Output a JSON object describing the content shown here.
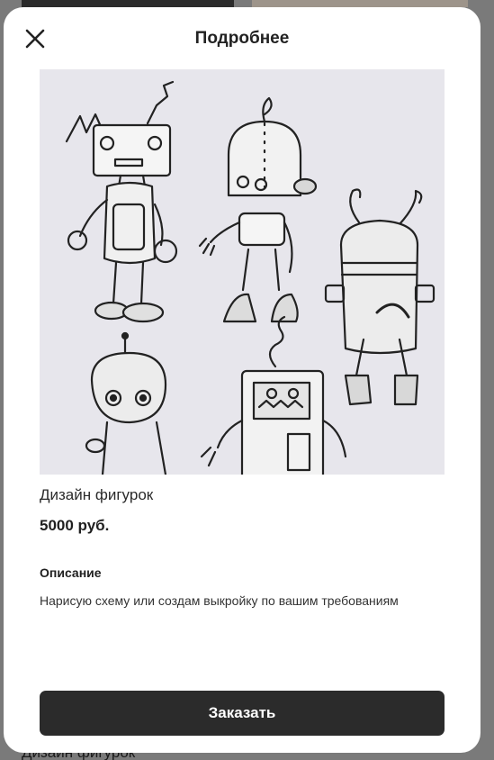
{
  "modal": {
    "title": "Подробнее",
    "close_icon": "close-icon"
  },
  "product": {
    "name": "Дизайн фигурок",
    "price": "5000 руб.",
    "image": "robots-sketch-illustration",
    "description_heading": "Описание",
    "description": "Нарисую схему или создам выкройку по вашим требованиям"
  },
  "actions": {
    "order_label": "Заказать"
  },
  "background_page": {
    "caption": "Дизайн фигурок"
  },
  "colors": {
    "button_bg": "#2b2b2b",
    "modal_bg": "#ffffff",
    "overlay": "#7a7a7a"
  }
}
